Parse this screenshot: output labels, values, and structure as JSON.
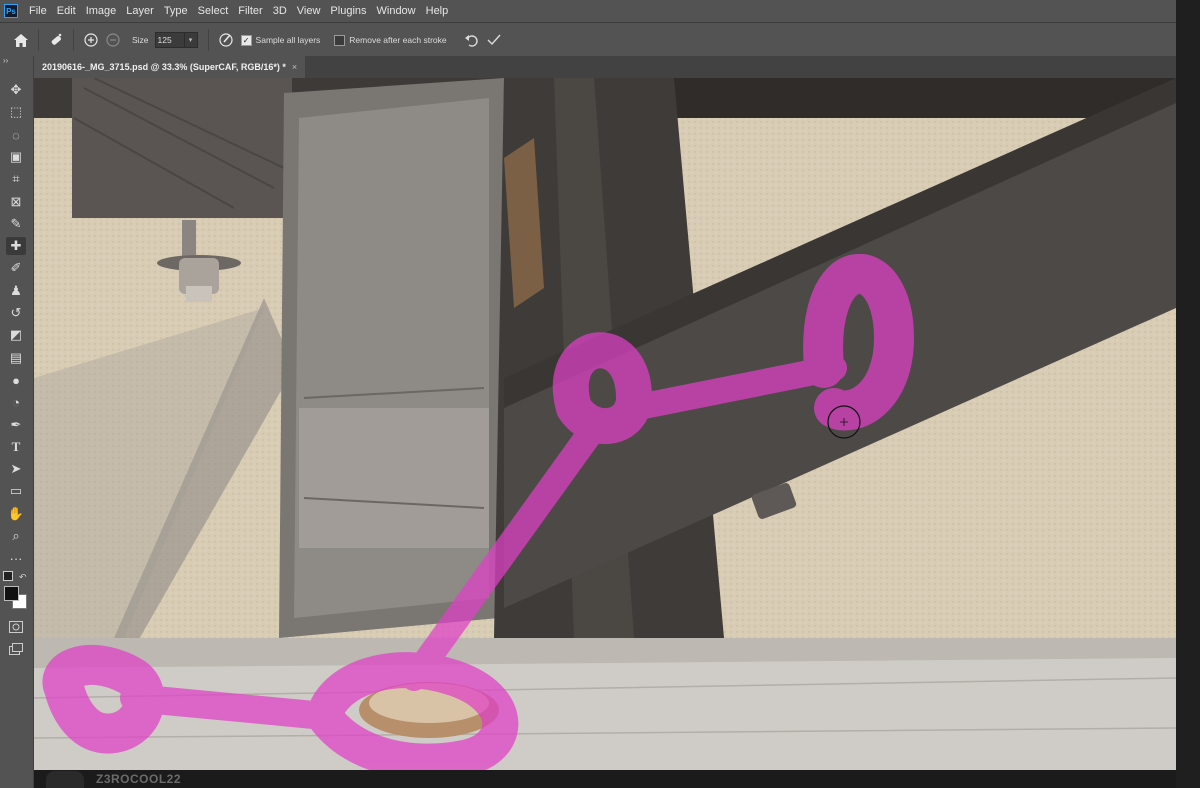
{
  "app": {
    "logo": "Ps"
  },
  "menu": [
    "File",
    "Edit",
    "Image",
    "Layer",
    "Type",
    "Select",
    "Filter",
    "3D",
    "View",
    "Plugins",
    "Window",
    "Help"
  ],
  "options": {
    "home_icon": "home-icon",
    "brush_icon": "spot-healing-brush-icon",
    "size_label": "Size",
    "size_value": "125",
    "sample_all_layers_label": "Sample all layers",
    "sample_all_layers_checked": true,
    "remove_after_label": "Remove after each stroke",
    "remove_after_checked": false
  },
  "document_tab": {
    "title": "20190616-_MG_3715.psd @ 33.3% (SuperCAF, RGB/16*) *",
    "close": "×"
  },
  "tools": [
    "move-icon",
    "marquee-icon",
    "lasso-icon",
    "object-select-icon",
    "crop-icon",
    "frame-icon",
    "eyedropper-icon",
    "spot-healing-icon",
    "brush-icon",
    "clone-stamp-icon",
    "history-brush-icon",
    "eraser-icon",
    "gradient-icon",
    "blur-icon",
    "dodge-icon",
    "pen-icon",
    "type-icon",
    "path-select-icon",
    "rectangle-icon",
    "hand-icon",
    "zoom-icon",
    "more-tools-icon"
  ],
  "colors": {
    "foreground": "#111111",
    "background": "#ffffff",
    "stroke_overlay": "#e040c8"
  },
  "watermark": "Z3ROCOOL22"
}
